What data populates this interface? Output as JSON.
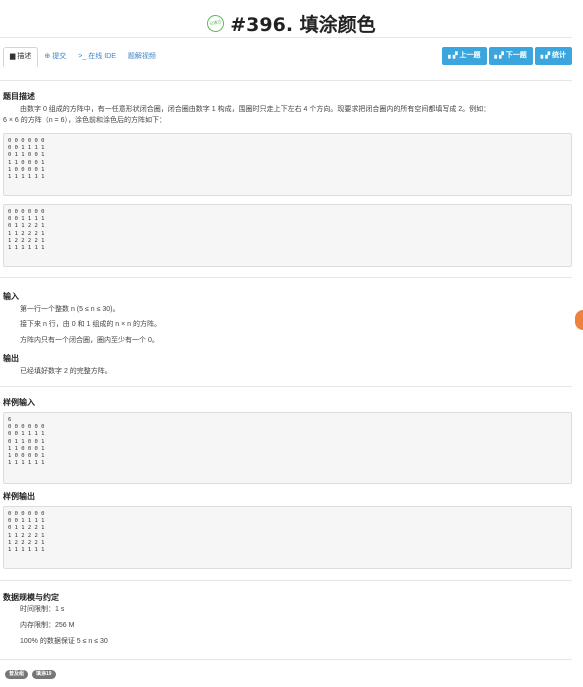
{
  "header": {
    "badge_text": "已通过",
    "title": "#396. 填涂颜色"
  },
  "tabs": [
    {
      "label": "描述",
      "icon": "file-icon"
    },
    {
      "label": "提交",
      "icon": "submit-icon"
    },
    {
      "label": "在线 IDE",
      "icon": "terminal-icon"
    },
    {
      "label": "题解视频",
      "icon": ""
    }
  ],
  "nav_buttons": {
    "prev": "上一题",
    "next": "下一题",
    "stats": "统计"
  },
  "description": {
    "heading": "题目描述",
    "line1": "由数字 0 组成的方阵中，有一任意形状闭合圈，闭合圈由数字 1 构成，围圈时只走上下左右 4 个方向。现要求把闭合圈内的所有空间都填写成 2。例如：",
    "line2": "6 × 6 的方阵（n = 6），涂色前和涂色后的方阵如下：",
    "before": "0 0 0 0 0 0\n0 0 1 1 1 1\n0 1 1 0 0 1\n1 1 0 0 0 1\n1 0 0 0 0 1\n1 1 1 1 1 1",
    "after": "0 0 0 0 0 0\n0 0 1 1 1 1\n0 1 1 2 2 1\n1 1 2 2 2 1\n1 2 2 2 2 1\n1 1 1 1 1 1"
  },
  "input": {
    "heading": "输入",
    "line1": "第一行一个整数 n (5 ≤ n ≤ 30)。",
    "line2": "接下来 n 行，由 0 和 1 组成的 n × n 的方阵。",
    "line3": "方阵内只有一个闭合圈，圈内至少有一个 0。"
  },
  "output": {
    "heading": "输出",
    "line1": "已经填好数字 2 的完整方阵。"
  },
  "sample_input": {
    "heading": "样例输入",
    "content": "6\n0 0 0 0 0 0\n0 0 1 1 1 1\n0 1 1 0 0 1\n1 1 0 0 0 1\n1 0 0 0 0 1\n1 1 1 1 1 1"
  },
  "sample_output": {
    "heading": "样例输出",
    "content": "0 0 0 0 0 0\n0 0 1 1 1 1\n0 1 1 2 2 1\n1 1 2 2 2 1\n1 2 2 2 2 1\n1 1 1 1 1 1"
  },
  "limits": {
    "heading": "数据规模与约定",
    "time": "时间限制：1 s",
    "memory": "内存限制：256 M",
    "guarantee": "100% 的数据保证 5 ≤ n ≤ 30"
  },
  "tags": [
    "普及组",
    "填涂19"
  ]
}
